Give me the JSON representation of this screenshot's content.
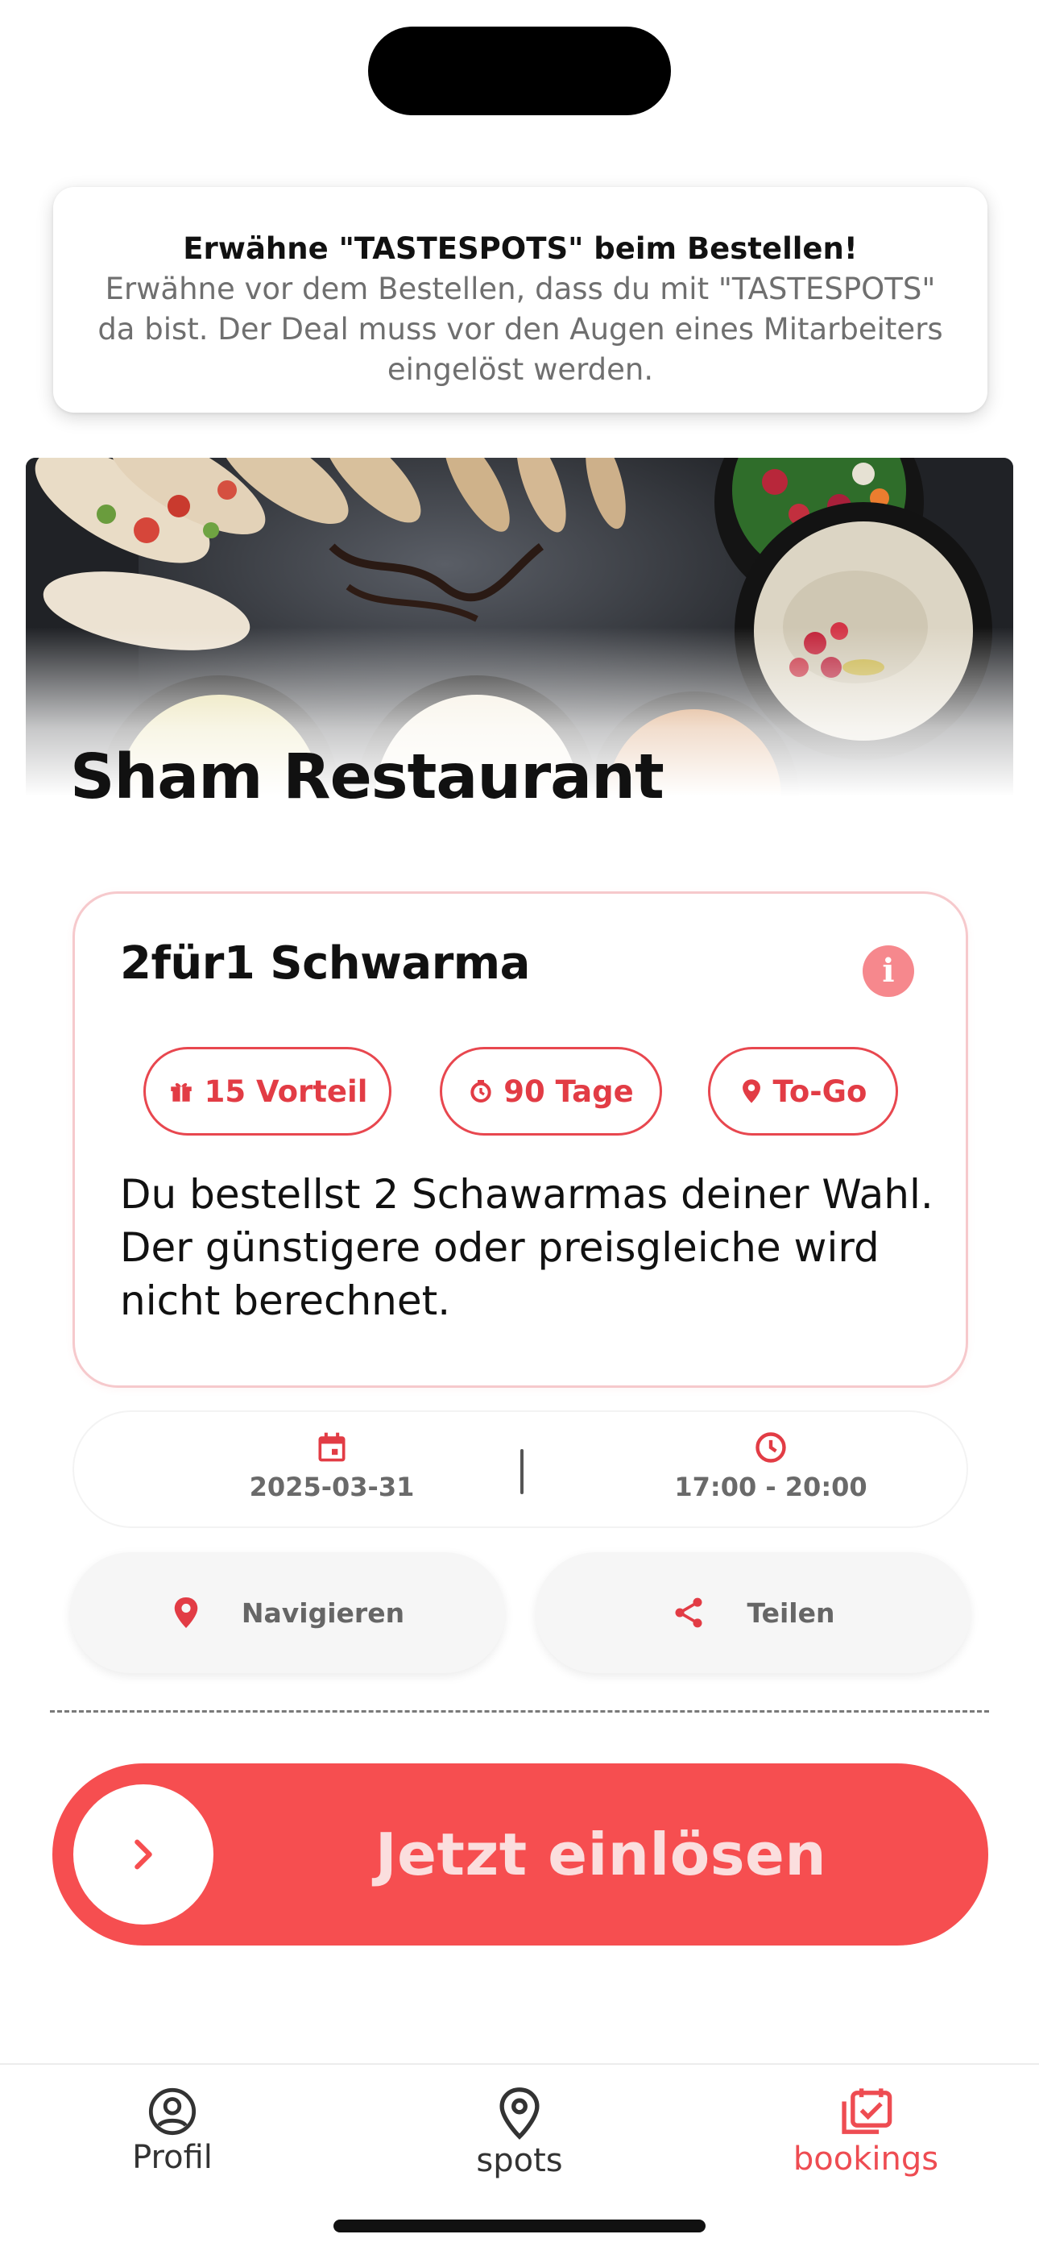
{
  "notice": {
    "title": "Erwähne \"TASTESPOTS\" beim Bestellen!",
    "body": "Erwähne vor dem Bestellen, dass du mit \"TASTESPOTS\" da bist. Der Deal muss vor den Augen eines Mitarbeiters eingelöst werden."
  },
  "restaurant": {
    "name": "Sham Restaurant",
    "image_alt": "food-platter-photo"
  },
  "deal": {
    "title": "2für1 Schwarma",
    "info_icon": "info-icon",
    "chips": [
      {
        "icon": "gift-icon",
        "label": "15 Vorteil"
      },
      {
        "icon": "timer-icon",
        "label": "90 Tage"
      },
      {
        "icon": "location-pin-icon",
        "label": "To-Go"
      }
    ],
    "description": "Du bestellst 2 Schawarmas deiner Wahl. Der günstigere oder preisgleiche wird nicht berechnet."
  },
  "schedule": {
    "date": "2025-03-31",
    "time": "17:00 - 20:00"
  },
  "actions": {
    "navigate_label": "Navigieren",
    "share_label": "Teilen"
  },
  "redeem": {
    "label": "Jetzt einlösen"
  },
  "tabs": [
    {
      "label": "Profil",
      "icon": "profile-icon",
      "active": false
    },
    {
      "label": "spots",
      "icon": "location-pin-icon",
      "active": false
    },
    {
      "label": "bookings",
      "icon": "calendar-check-icon",
      "active": true
    }
  ],
  "colors": {
    "accent": "#f64e50",
    "accent_text": "#e23c45",
    "muted_text": "#6f6f6f"
  }
}
